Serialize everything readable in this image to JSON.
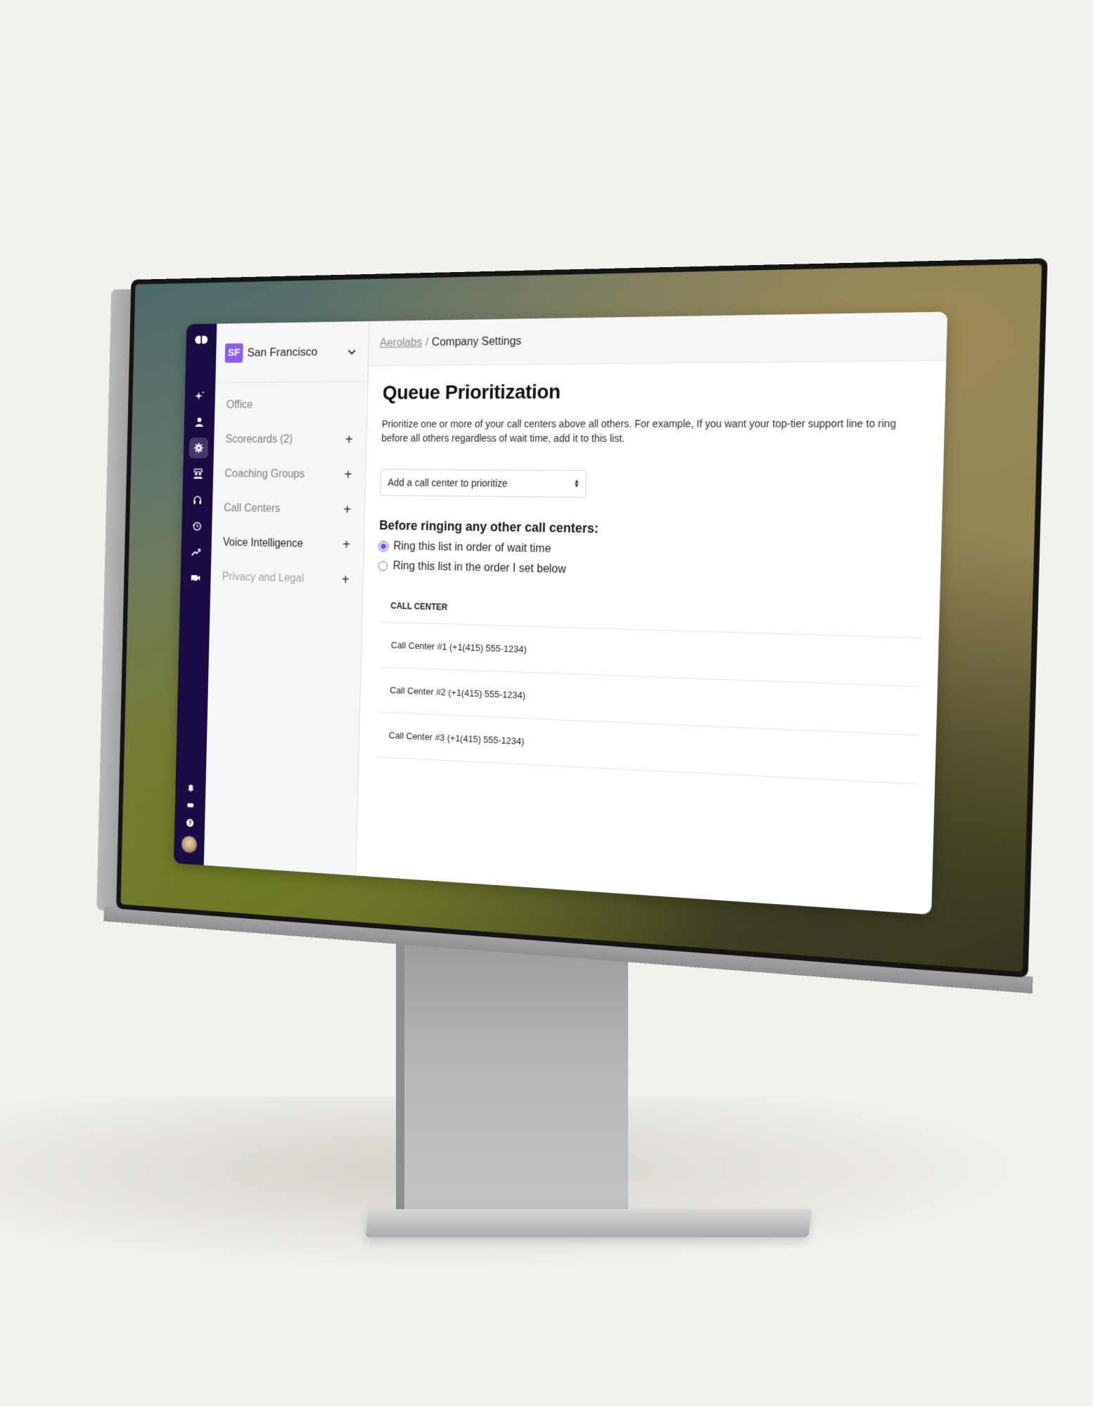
{
  "app": {
    "org": {
      "initials": "SF",
      "name": "San Francisco"
    },
    "rail": {
      "items": [
        {
          "name": "sparkles-icon",
          "label": "AI"
        },
        {
          "name": "user-icon",
          "label": "Contacts"
        },
        {
          "name": "gear-icon",
          "label": "Settings",
          "active": true
        },
        {
          "name": "coaching-icon",
          "label": "Coaching"
        },
        {
          "name": "headset-icon",
          "label": "Call Centers"
        },
        {
          "name": "history-icon",
          "label": "History"
        },
        {
          "name": "trend-icon",
          "label": "Analytics"
        },
        {
          "name": "video-icon",
          "label": "Meetings"
        }
      ],
      "bottom": [
        {
          "name": "bell-icon"
        },
        {
          "name": "chat-icon"
        },
        {
          "name": "help-icon"
        }
      ]
    },
    "sidebar": {
      "items": [
        {
          "label": "Office",
          "has_plus": false,
          "state": "default"
        },
        {
          "label": "Scorecards (2)",
          "has_plus": true,
          "state": "default"
        },
        {
          "label": "Coaching Groups",
          "has_plus": true,
          "state": "default"
        },
        {
          "label": "Call Centers",
          "has_plus": true,
          "state": "default"
        },
        {
          "label": "Voice Intelligence",
          "has_plus": true,
          "state": "active"
        },
        {
          "label": "Privacy and Legal",
          "has_plus": true,
          "state": "muted"
        }
      ],
      "plus_symbol": "+"
    },
    "breadcrumb": {
      "parent": "Aerolabs",
      "separator": "/",
      "current": "Company Settings"
    },
    "page": {
      "title": "Queue Prioritization",
      "description": "Prioritize one or more of your call centers above all others. For example, If you want your top-tier support line to ring before all others regardless of wait time, add it to this list.",
      "select": {
        "placeholder": "Add a call center to prioritize"
      },
      "ring_section": {
        "title": "Before ringing any other call centers:",
        "options": [
          {
            "label": "Ring this list in order of wait time",
            "checked": true
          },
          {
            "label": "Ring this list in the order I set below",
            "checked": false
          }
        ]
      },
      "table": {
        "header": "CALL CENTER",
        "rows": [
          "Call Center #1 (+1(415) 555-1234)",
          "Call Center #2 (+1(415) 555-1234)",
          "Call Center #3 (+1(415) 555-1234)"
        ]
      }
    },
    "colors": {
      "rail": "#1a0b45",
      "accent": "#8a5cf6"
    }
  }
}
